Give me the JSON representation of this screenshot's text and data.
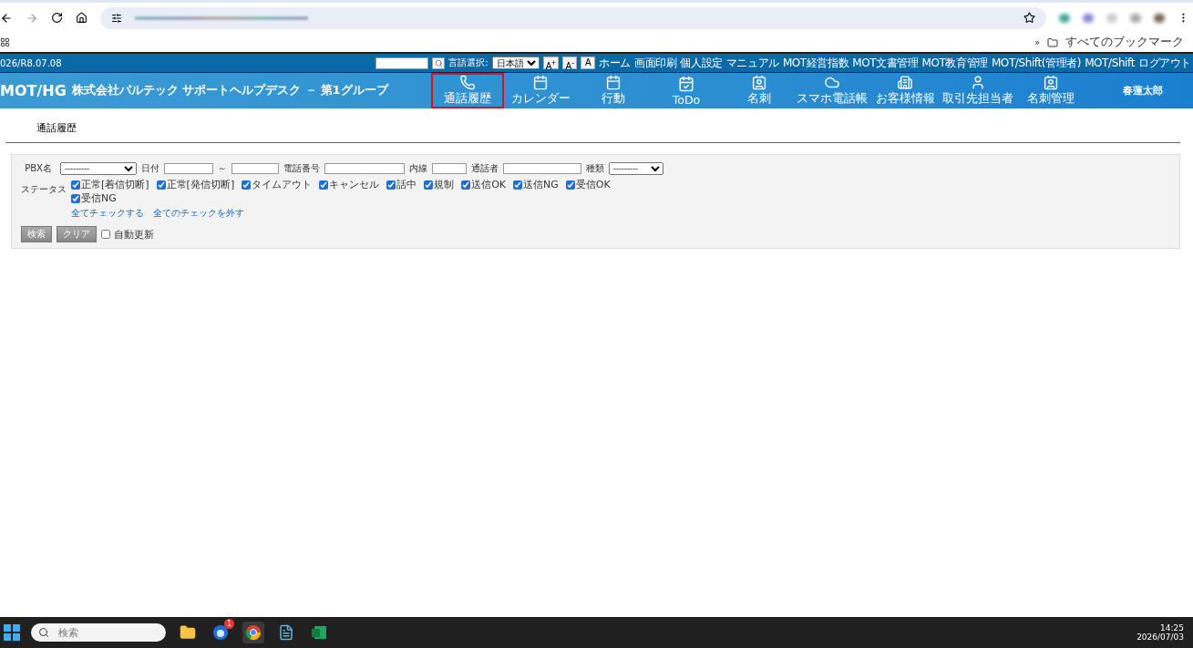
{
  "browser": {
    "bookmarks_label": "すべてのブックマーク",
    "overflow": "»"
  },
  "topbar": {
    "date": "026/R8.07.08",
    "language_label": "言語選択:",
    "language": "日本語",
    "font_buttons": [
      "A$^{+}$",
      "A$^{-}$",
      "A"
    ],
    "links": [
      "ホーム",
      "画面印刷",
      "個人設定",
      "マニュアル",
      "MOT経営指数",
      "MOT文書管理",
      "MOT教育管理",
      "MOT/Shift(管理者)",
      "MOT/Shift",
      "ログアウト"
    ]
  },
  "header": {
    "logo": "MOT/HG",
    "company": "株式会社パルテック サポートヘルプデスク － 第1グループ",
    "user": "春蓮太郎",
    "nav": [
      {
        "label": "通話履歴",
        "kind": "phone",
        "selected": true
      },
      {
        "label": "カレンダー",
        "kind": "calendar",
        "selected": false
      },
      {
        "label": "行動",
        "kind": "calendar",
        "selected": false
      },
      {
        "label": "ToDo",
        "kind": "todo",
        "selected": false
      },
      {
        "label": "名刺",
        "kind": "card",
        "selected": false
      },
      {
        "label": "スマホ電話帳",
        "kind": "cloud",
        "selected": false
      },
      {
        "label": "お客様情報",
        "kind": "building",
        "selected": false
      },
      {
        "label": "取引先担当者",
        "kind": "person",
        "selected": false
      },
      {
        "label": "名刺管理",
        "kind": "card",
        "selected": false
      }
    ]
  },
  "page": {
    "title": "通話履歴"
  },
  "filter": {
    "pbx_label": "PBX名",
    "pbx_value": "---------",
    "date_label": "日付",
    "date_sep": "～",
    "phone_label": "電話番号",
    "ext_label": "内線",
    "caller_label": "通話者",
    "type_label": "種類",
    "type_value": "---------",
    "status_label": "ステータス",
    "statuses": [
      {
        "label": "正常[着信切断]",
        "checked": true
      },
      {
        "label": "正常[発信切断]",
        "checked": true
      },
      {
        "label": "タイムアウト",
        "checked": true
      },
      {
        "label": "キャンセル",
        "checked": true
      },
      {
        "label": "話中",
        "checked": true
      },
      {
        "label": "規制",
        "checked": true
      },
      {
        "label": "送信OK",
        "checked": true
      },
      {
        "label": "送信NG",
        "checked": true
      },
      {
        "label": "受信OK",
        "checked": true
      },
      {
        "label": "受信NG",
        "checked": true
      }
    ],
    "check_all": "全てチェックする",
    "uncheck_all": "全てのチェックを外す",
    "search_button": "検索",
    "clear_button": "クリア",
    "auto_refresh": {
      "label": "自動更新",
      "checked": false
    }
  },
  "taskbar": {
    "search_placeholder": "検索",
    "badge": "1",
    "time": "14:25",
    "date": "2026/07/03"
  }
}
